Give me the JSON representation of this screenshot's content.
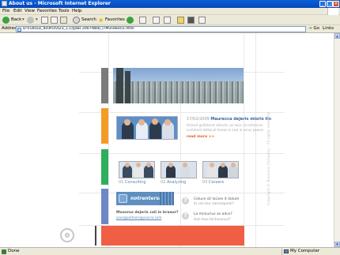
{
  "window": {
    "title": "About us - Microsoft Internet Explorer"
  },
  "menu": [
    "File",
    "Edit",
    "View",
    "Favorites",
    "Tools",
    "Help"
  ],
  "toolbar": {
    "back_label": "Back",
    "search_label": "Search",
    "favorites_label": "Favorites"
  },
  "address": {
    "label": "Address",
    "url": "D:\\Fulls\\us_do\\Pics\\A23_1,1)\\Jobs 2007\\Web_\\TM\\indoes\\1.html",
    "go_label": "Go",
    "links_label": "Links"
  },
  "status": {
    "text": "Done",
    "zone": "My Computer"
  },
  "page": {
    "news": {
      "date": "17/02/2009",
      "headline": "Maurecca dejeris mioris tin",
      "body_lines": [
        "Octivet gellisternt dolecte, as mice. la infrancon",
        "Lorement dellocuti feroes la saul la serus paeres"
      ],
      "read_more": "read more >>"
    },
    "thumbs": [
      {
        "num": "01",
        "label": "Consulting"
      },
      {
        "num": "02",
        "label": "Analyzing"
      },
      {
        "num": "03",
        "label": "Careers"
      }
    ],
    "banner": {
      "text": "notrentersrenti"
    },
    "contact": {
      "question": "Mouvrus dejeris cali in braaur?",
      "link": "your@partners@yourco.com"
    },
    "faq": [
      {
        "q": "Celuce sit locare it dolum",
        "a": "la cal siur consequeis?"
      },
      {
        "q": "La miniurius as adco?",
        "a": "Aut mus lechunsuvi?"
      }
    ],
    "copyright": "Copyright © Business Company - All rights reserved",
    "colors": {
      "bar_gray": "#7b7b7b",
      "bar_orange": "#f39c25",
      "bar_green": "#2fae5e",
      "bar_blue": "#6f86c7",
      "footer": "#f05f44"
    }
  }
}
